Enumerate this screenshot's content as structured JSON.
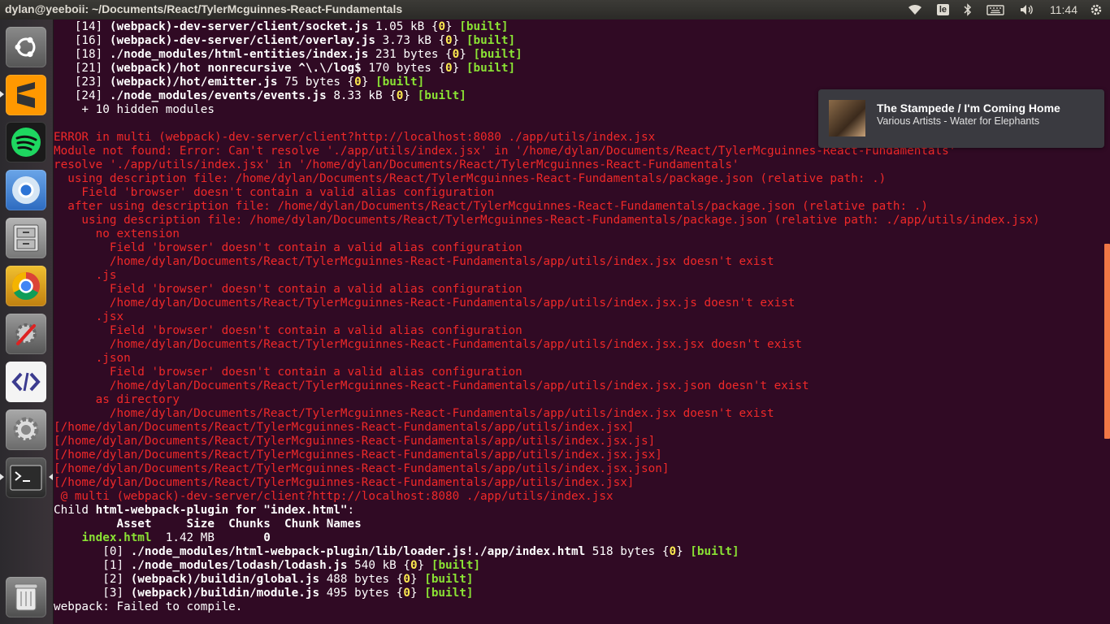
{
  "window": {
    "title": "dylan@yeeboii: ~/Documents/React/TylerMcguinnes-React-Fundamentals"
  },
  "panel": {
    "keyboard_layout": "le",
    "clock": "11:44",
    "indicators": [
      "wifi-icon",
      "keyboard-icon",
      "bluetooth-icon",
      "battery-icon",
      "volume-icon"
    ]
  },
  "launcher": {
    "items": [
      {
        "name": "ubuntu-dash",
        "icon": "ubuntu-logo-icon",
        "color": "#6b6b6b"
      },
      {
        "name": "sublime-text",
        "icon": "sublime-text-icon",
        "color": "#ff9800"
      },
      {
        "name": "spotify",
        "icon": "spotify-icon",
        "color": "#1ed760"
      },
      {
        "name": "chromium",
        "icon": "chromium-icon",
        "color": "#4a90d9"
      },
      {
        "name": "files",
        "icon": "file-cabinet-icon",
        "color": "#8d8d8d"
      },
      {
        "name": "chrome",
        "icon": "chrome-icon",
        "color": "#e8463a"
      },
      {
        "name": "system-tools",
        "icon": "wrench-screwdriver-icon",
        "color": "#7a7a7a"
      },
      {
        "name": "code-editor",
        "icon": "code-brackets-icon",
        "color": "#e6e6e6"
      },
      {
        "name": "settings",
        "icon": "gear-icon",
        "color": "#9a9a9a"
      },
      {
        "name": "terminal",
        "icon": "terminal-icon",
        "color": "#2c2c2c"
      },
      {
        "name": "trash",
        "icon": "trash-icon",
        "color": "#9a9a9a"
      }
    ]
  },
  "notification": {
    "title": "The Stampede / I'm Coming Home",
    "body": "Various Artists - Water for Elephants"
  },
  "terminal": {
    "lines": [
      {
        "segs": [
          {
            "t": "   [14] ",
            "c": "n"
          },
          {
            "t": "(webpack)-dev-server/client/socket.js",
            "c": "w"
          },
          {
            "t": " 1.05 kB ",
            "c": "n"
          },
          {
            "t": "{",
            "c": "n"
          },
          {
            "t": "0",
            "c": "y"
          },
          {
            "t": "} ",
            "c": "n"
          },
          {
            "t": "[built]",
            "c": "green"
          }
        ]
      },
      {
        "segs": [
          {
            "t": "   [16] ",
            "c": "n"
          },
          {
            "t": "(webpack)-dev-server/client/overlay.js",
            "c": "w"
          },
          {
            "t": " 3.73 kB ",
            "c": "n"
          },
          {
            "t": "{",
            "c": "n"
          },
          {
            "t": "0",
            "c": "y"
          },
          {
            "t": "} ",
            "c": "n"
          },
          {
            "t": "[built]",
            "c": "green"
          }
        ]
      },
      {
        "segs": [
          {
            "t": "   [18] ",
            "c": "n"
          },
          {
            "t": "./node_modules/html-entities/index.js",
            "c": "w"
          },
          {
            "t": " 231 bytes ",
            "c": "n"
          },
          {
            "t": "{",
            "c": "n"
          },
          {
            "t": "0",
            "c": "y"
          },
          {
            "t": "} ",
            "c": "n"
          },
          {
            "t": "[built]",
            "c": "green"
          }
        ]
      },
      {
        "segs": [
          {
            "t": "   [21] ",
            "c": "n"
          },
          {
            "t": "(webpack)/hot nonrecursive ^\\.\\/log$",
            "c": "w"
          },
          {
            "t": " 170 bytes ",
            "c": "n"
          },
          {
            "t": "{",
            "c": "n"
          },
          {
            "t": "0",
            "c": "y"
          },
          {
            "t": "} ",
            "c": "n"
          },
          {
            "t": "[built]",
            "c": "green"
          }
        ]
      },
      {
        "segs": [
          {
            "t": "   [23] ",
            "c": "n"
          },
          {
            "t": "(webpack)/hot/emitter.js",
            "c": "w"
          },
          {
            "t": " 75 bytes ",
            "c": "n"
          },
          {
            "t": "{",
            "c": "n"
          },
          {
            "t": "0",
            "c": "y"
          },
          {
            "t": "} ",
            "c": "n"
          },
          {
            "t": "[built]",
            "c": "green"
          }
        ]
      },
      {
        "segs": [
          {
            "t": "   [24] ",
            "c": "n"
          },
          {
            "t": "./node_modules/events/events.js",
            "c": "w"
          },
          {
            "t": " 8.33 kB ",
            "c": "n"
          },
          {
            "t": "{",
            "c": "n"
          },
          {
            "t": "0",
            "c": "y"
          },
          {
            "t": "} ",
            "c": "n"
          },
          {
            "t": "[built]",
            "c": "green"
          }
        ]
      },
      {
        "segs": [
          {
            "t": "    + 10 hidden modules",
            "c": "n"
          }
        ]
      },
      {
        "segs": [
          {
            "t": "",
            "c": "n"
          }
        ]
      },
      {
        "segs": [
          {
            "t": "ERROR in multi (webpack)-dev-server/client?http://localhost:8080 ./app/utils/index.jsx",
            "c": "red"
          }
        ]
      },
      {
        "segs": [
          {
            "t": "Module not found: Error: Can't resolve './app/utils/index.jsx' in '/home/dylan/Documents/React/TylerMcguinnes-React-Fundamentals'",
            "c": "red"
          }
        ]
      },
      {
        "segs": [
          {
            "t": "resolve './app/utils/index.jsx' in '/home/dylan/Documents/React/TylerMcguinnes-React-Fundamentals'",
            "c": "red"
          }
        ]
      },
      {
        "segs": [
          {
            "t": "  using description file: /home/dylan/Documents/React/TylerMcguinnes-React-Fundamentals/package.json (relative path: .)",
            "c": "red"
          }
        ]
      },
      {
        "segs": [
          {
            "t": "    Field 'browser' doesn't contain a valid alias configuration",
            "c": "red"
          }
        ]
      },
      {
        "segs": [
          {
            "t": "  after using description file: /home/dylan/Documents/React/TylerMcguinnes-React-Fundamentals/package.json (relative path: .)",
            "c": "red"
          }
        ]
      },
      {
        "segs": [
          {
            "t": "    using description file: /home/dylan/Documents/React/TylerMcguinnes-React-Fundamentals/package.json (relative path: ./app/utils/index.jsx)",
            "c": "red"
          }
        ]
      },
      {
        "segs": [
          {
            "t": "      no extension",
            "c": "red"
          }
        ]
      },
      {
        "segs": [
          {
            "t": "        Field 'browser' doesn't contain a valid alias configuration",
            "c": "red"
          }
        ]
      },
      {
        "segs": [
          {
            "t": "        /home/dylan/Documents/React/TylerMcguinnes-React-Fundamentals/app/utils/index.jsx doesn't exist",
            "c": "red"
          }
        ]
      },
      {
        "segs": [
          {
            "t": "      .js",
            "c": "red"
          }
        ]
      },
      {
        "segs": [
          {
            "t": "        Field 'browser' doesn't contain a valid alias configuration",
            "c": "red"
          }
        ]
      },
      {
        "segs": [
          {
            "t": "        /home/dylan/Documents/React/TylerMcguinnes-React-Fundamentals/app/utils/index.jsx.js doesn't exist",
            "c": "red"
          }
        ]
      },
      {
        "segs": [
          {
            "t": "      .jsx",
            "c": "red"
          }
        ]
      },
      {
        "segs": [
          {
            "t": "        Field 'browser' doesn't contain a valid alias configuration",
            "c": "red"
          }
        ]
      },
      {
        "segs": [
          {
            "t": "        /home/dylan/Documents/React/TylerMcguinnes-React-Fundamentals/app/utils/index.jsx.jsx doesn't exist",
            "c": "red"
          }
        ]
      },
      {
        "segs": [
          {
            "t": "      .json",
            "c": "red"
          }
        ]
      },
      {
        "segs": [
          {
            "t": "        Field 'browser' doesn't contain a valid alias configuration",
            "c": "red"
          }
        ]
      },
      {
        "segs": [
          {
            "t": "        /home/dylan/Documents/React/TylerMcguinnes-React-Fundamentals/app/utils/index.jsx.json doesn't exist",
            "c": "red"
          }
        ]
      },
      {
        "segs": [
          {
            "t": "      as directory",
            "c": "red"
          }
        ]
      },
      {
        "segs": [
          {
            "t": "        /home/dylan/Documents/React/TylerMcguinnes-React-Fundamentals/app/utils/index.jsx doesn't exist",
            "c": "red"
          }
        ]
      },
      {
        "segs": [
          {
            "t": "[/home/dylan/Documents/React/TylerMcguinnes-React-Fundamentals/app/utils/index.jsx]",
            "c": "red"
          }
        ]
      },
      {
        "segs": [
          {
            "t": "[/home/dylan/Documents/React/TylerMcguinnes-React-Fundamentals/app/utils/index.jsx.js]",
            "c": "red"
          }
        ]
      },
      {
        "segs": [
          {
            "t": "[/home/dylan/Documents/React/TylerMcguinnes-React-Fundamentals/app/utils/index.jsx.jsx]",
            "c": "red"
          }
        ]
      },
      {
        "segs": [
          {
            "t": "[/home/dylan/Documents/React/TylerMcguinnes-React-Fundamentals/app/utils/index.jsx.json]",
            "c": "red"
          }
        ]
      },
      {
        "segs": [
          {
            "t": "[/home/dylan/Documents/React/TylerMcguinnes-React-Fundamentals/app/utils/index.jsx]",
            "c": "red"
          }
        ]
      },
      {
        "segs": [
          {
            "t": " @ multi (webpack)-dev-server/client?http://localhost:8080 ./app/utils/index.jsx",
            "c": "red"
          }
        ]
      },
      {
        "segs": [
          {
            "t": "Child ",
            "c": "n"
          },
          {
            "t": "html-webpack-plugin for \"index.html\"",
            "c": "w"
          },
          {
            "t": ":",
            "c": "n"
          }
        ]
      },
      {
        "segs": [
          {
            "t": "         Asset     Size  Chunks  Chunk Names",
            "c": "w"
          }
        ]
      },
      {
        "segs": [
          {
            "t": "    ",
            "c": "n"
          },
          {
            "t": "index.html",
            "c": "green"
          },
          {
            "t": "  1.42 MB       ",
            "c": "n"
          },
          {
            "t": "0",
            "c": "w"
          }
        ]
      },
      {
        "segs": [
          {
            "t": "       [0] ",
            "c": "n"
          },
          {
            "t": "./node_modules/html-webpack-plugin/lib/loader.js!./app/index.html",
            "c": "w"
          },
          {
            "t": " 518 bytes ",
            "c": "n"
          },
          {
            "t": "{",
            "c": "n"
          },
          {
            "t": "0",
            "c": "y"
          },
          {
            "t": "} ",
            "c": "n"
          },
          {
            "t": "[built]",
            "c": "green"
          }
        ]
      },
      {
        "segs": [
          {
            "t": "       [1] ",
            "c": "n"
          },
          {
            "t": "./node_modules/lodash/lodash.js",
            "c": "w"
          },
          {
            "t": " 540 kB ",
            "c": "n"
          },
          {
            "t": "{",
            "c": "n"
          },
          {
            "t": "0",
            "c": "y"
          },
          {
            "t": "} ",
            "c": "n"
          },
          {
            "t": "[built]",
            "c": "green"
          }
        ]
      },
      {
        "segs": [
          {
            "t": "       [2] ",
            "c": "n"
          },
          {
            "t": "(webpack)/buildin/global.js",
            "c": "w"
          },
          {
            "t": " 488 bytes ",
            "c": "n"
          },
          {
            "t": "{",
            "c": "n"
          },
          {
            "t": "0",
            "c": "y"
          },
          {
            "t": "} ",
            "c": "n"
          },
          {
            "t": "[built]",
            "c": "green"
          }
        ]
      },
      {
        "segs": [
          {
            "t": "       [3] ",
            "c": "n"
          },
          {
            "t": "(webpack)/buildin/module.js",
            "c": "w"
          },
          {
            "t": " 495 bytes ",
            "c": "n"
          },
          {
            "t": "{",
            "c": "n"
          },
          {
            "t": "0",
            "c": "y"
          },
          {
            "t": "} ",
            "c": "n"
          },
          {
            "t": "[built]",
            "c": "green"
          }
        ]
      },
      {
        "segs": [
          {
            "t": "webpack: Failed to compile.",
            "c": "n"
          }
        ]
      }
    ]
  }
}
